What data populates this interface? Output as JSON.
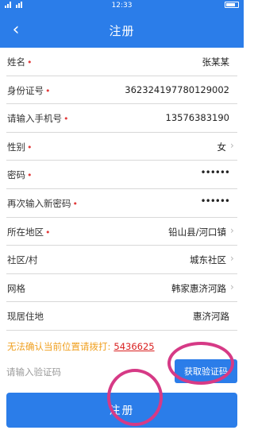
{
  "status_bar": {
    "time": "12:33"
  },
  "header": {
    "back_icon": "chevron-left-icon",
    "title": "注册"
  },
  "form_rows": [
    {
      "label": "姓名",
      "required": true,
      "value": "张某某",
      "chevron": false,
      "masked": false
    },
    {
      "label": "身份证号",
      "required": true,
      "value": "362324197780129002",
      "chevron": false,
      "masked": false
    },
    {
      "label": "请输入手机号",
      "required": true,
      "value": "13576383190",
      "chevron": false,
      "masked": false
    },
    {
      "label": "性别",
      "required": true,
      "value": "女",
      "chevron": true,
      "masked": false
    },
    {
      "label": "密码",
      "required": true,
      "value": "••••••",
      "chevron": false,
      "masked": true
    },
    {
      "label": "再次输入新密码",
      "required": true,
      "value": "••••••",
      "chevron": false,
      "masked": true
    },
    {
      "label": "所在地区",
      "required": true,
      "value": "铅山县/河口镇",
      "chevron": true,
      "masked": false
    },
    {
      "label": "社区/村",
      "required": false,
      "value": "城东社区",
      "chevron": true,
      "masked": false
    },
    {
      "label": "网格",
      "required": false,
      "value": "韩家惠济河路",
      "chevron": true,
      "masked": false
    },
    {
      "label": "现居住地",
      "required": false,
      "value": "惠济河路",
      "chevron": false,
      "masked": false
    }
  ],
  "required_marker": "•",
  "chevron_glyph": "›",
  "notice": {
    "text": "无法确认当前位置请拨打:",
    "phone": "5436625"
  },
  "verification": {
    "placeholder": "请输入验证码",
    "button_label": "获取验证码"
  },
  "submit": {
    "label": "注册"
  },
  "colors": {
    "primary": "#2b7de9",
    "required": "#e23b3b",
    "notice": "#f0a020",
    "phone": "#d92020",
    "annotation": "#d63a86"
  }
}
